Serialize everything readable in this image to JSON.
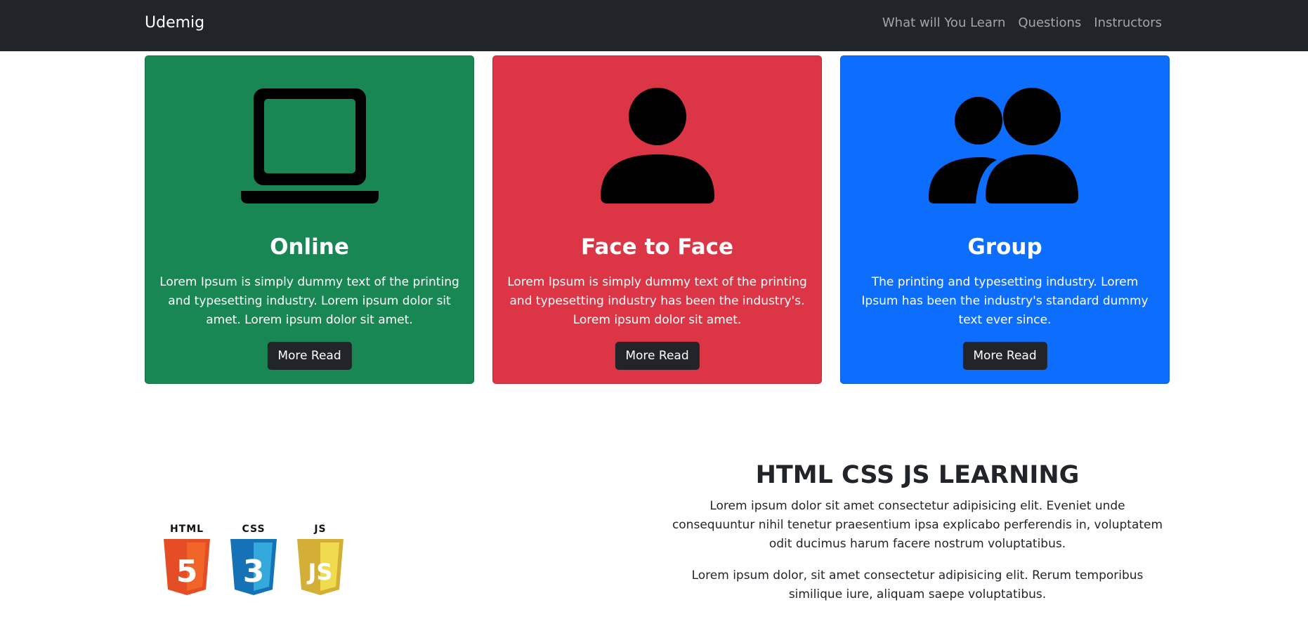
{
  "navbar": {
    "brand": "Udemig",
    "links": [
      "What will You Learn",
      "Questions",
      "Instructors"
    ]
  },
  "cards": [
    {
      "title": "Online",
      "text": "Lorem Ipsum is simply dummy text of the printing and typesetting industry. Lorem ipsum dolor sit amet. Lorem ipsum dolor sit amet.",
      "button": "More Read",
      "color": "#198754",
      "icon": "laptop-icon"
    },
    {
      "title": "Face to Face",
      "text": "Lorem Ipsum is simply dummy text of the printing and typesetting industry has been the industry's. Lorem ipsum dolor sit amet.",
      "button": "More Read",
      "color": "#dc3545",
      "icon": "person-icon"
    },
    {
      "title": "Group",
      "text": "The printing and typesetting industry. Lorem Ipsum has been the industry's standard dummy text ever since.",
      "button": "More Read",
      "color": "#0d6efd",
      "icon": "people-icon"
    }
  ],
  "learning": {
    "title": "HTML CSS JS LEARNING",
    "paragraph1": "Lorem ipsum dolor sit amet consectetur adipisicing elit. Eveniet unde consequuntur nihil tenetur praesentium ipsa explicabo perferendis in, voluptatem odit ducimus harum facere nostrum voluptatibus.",
    "paragraph2": "Lorem ipsum dolor, sit amet consectetur adipisicing elit. Rerum temporibus similique iure, aliquam saepe voluptatibus.",
    "logos": [
      {
        "label": "HTML",
        "number": "5",
        "color": "#e44d26",
        "shade": "#f16529",
        "icon": "html5-icon"
      },
      {
        "label": "CSS",
        "number": "3",
        "color": "#1572b6",
        "shade": "#33a9dc",
        "icon": "css3-icon"
      },
      {
        "label": "JS",
        "number": "JS",
        "color": "#d4af37",
        "shade": "#f0db4f",
        "icon": "js-icon"
      }
    ]
  }
}
